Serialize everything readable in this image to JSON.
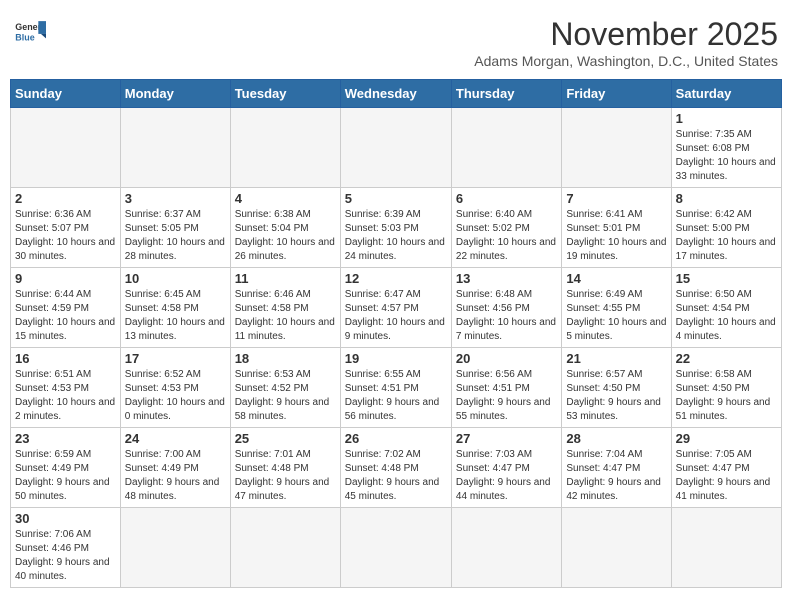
{
  "header": {
    "logo_general": "General",
    "logo_blue": "Blue",
    "month_title": "November 2025",
    "location": "Adams Morgan, Washington, D.C., United States"
  },
  "days_of_week": [
    "Sunday",
    "Monday",
    "Tuesday",
    "Wednesday",
    "Thursday",
    "Friday",
    "Saturday"
  ],
  "weeks": [
    [
      {
        "day": "",
        "info": ""
      },
      {
        "day": "",
        "info": ""
      },
      {
        "day": "",
        "info": ""
      },
      {
        "day": "",
        "info": ""
      },
      {
        "day": "",
        "info": ""
      },
      {
        "day": "",
        "info": ""
      },
      {
        "day": "1",
        "info": "Sunrise: 7:35 AM\nSunset: 6:08 PM\nDaylight: 10 hours\nand 33 minutes."
      }
    ],
    [
      {
        "day": "2",
        "info": "Sunrise: 6:36 AM\nSunset: 5:07 PM\nDaylight: 10 hours\nand 30 minutes."
      },
      {
        "day": "3",
        "info": "Sunrise: 6:37 AM\nSunset: 5:05 PM\nDaylight: 10 hours\nand 28 minutes."
      },
      {
        "day": "4",
        "info": "Sunrise: 6:38 AM\nSunset: 5:04 PM\nDaylight: 10 hours\nand 26 minutes."
      },
      {
        "day": "5",
        "info": "Sunrise: 6:39 AM\nSunset: 5:03 PM\nDaylight: 10 hours\nand 24 minutes."
      },
      {
        "day": "6",
        "info": "Sunrise: 6:40 AM\nSunset: 5:02 PM\nDaylight: 10 hours\nand 22 minutes."
      },
      {
        "day": "7",
        "info": "Sunrise: 6:41 AM\nSunset: 5:01 PM\nDaylight: 10 hours\nand 19 minutes."
      },
      {
        "day": "8",
        "info": "Sunrise: 6:42 AM\nSunset: 5:00 PM\nDaylight: 10 hours\nand 17 minutes."
      }
    ],
    [
      {
        "day": "9",
        "info": "Sunrise: 6:44 AM\nSunset: 4:59 PM\nDaylight: 10 hours\nand 15 minutes."
      },
      {
        "day": "10",
        "info": "Sunrise: 6:45 AM\nSunset: 4:58 PM\nDaylight: 10 hours\nand 13 minutes."
      },
      {
        "day": "11",
        "info": "Sunrise: 6:46 AM\nSunset: 4:58 PM\nDaylight: 10 hours\nand 11 minutes."
      },
      {
        "day": "12",
        "info": "Sunrise: 6:47 AM\nSunset: 4:57 PM\nDaylight: 10 hours\nand 9 minutes."
      },
      {
        "day": "13",
        "info": "Sunrise: 6:48 AM\nSunset: 4:56 PM\nDaylight: 10 hours\nand 7 minutes."
      },
      {
        "day": "14",
        "info": "Sunrise: 6:49 AM\nSunset: 4:55 PM\nDaylight: 10 hours\nand 5 minutes."
      },
      {
        "day": "15",
        "info": "Sunrise: 6:50 AM\nSunset: 4:54 PM\nDaylight: 10 hours\nand 4 minutes."
      }
    ],
    [
      {
        "day": "16",
        "info": "Sunrise: 6:51 AM\nSunset: 4:53 PM\nDaylight: 10 hours\nand 2 minutes."
      },
      {
        "day": "17",
        "info": "Sunrise: 6:52 AM\nSunset: 4:53 PM\nDaylight: 10 hours\nand 0 minutes."
      },
      {
        "day": "18",
        "info": "Sunrise: 6:53 AM\nSunset: 4:52 PM\nDaylight: 9 hours\nand 58 minutes."
      },
      {
        "day": "19",
        "info": "Sunrise: 6:55 AM\nSunset: 4:51 PM\nDaylight: 9 hours\nand 56 minutes."
      },
      {
        "day": "20",
        "info": "Sunrise: 6:56 AM\nSunset: 4:51 PM\nDaylight: 9 hours\nand 55 minutes."
      },
      {
        "day": "21",
        "info": "Sunrise: 6:57 AM\nSunset: 4:50 PM\nDaylight: 9 hours\nand 53 minutes."
      },
      {
        "day": "22",
        "info": "Sunrise: 6:58 AM\nSunset: 4:50 PM\nDaylight: 9 hours\nand 51 minutes."
      }
    ],
    [
      {
        "day": "23",
        "info": "Sunrise: 6:59 AM\nSunset: 4:49 PM\nDaylight: 9 hours\nand 50 minutes."
      },
      {
        "day": "24",
        "info": "Sunrise: 7:00 AM\nSunset: 4:49 PM\nDaylight: 9 hours\nand 48 minutes."
      },
      {
        "day": "25",
        "info": "Sunrise: 7:01 AM\nSunset: 4:48 PM\nDaylight: 9 hours\nand 47 minutes."
      },
      {
        "day": "26",
        "info": "Sunrise: 7:02 AM\nSunset: 4:48 PM\nDaylight: 9 hours\nand 45 minutes."
      },
      {
        "day": "27",
        "info": "Sunrise: 7:03 AM\nSunset: 4:47 PM\nDaylight: 9 hours\nand 44 minutes."
      },
      {
        "day": "28",
        "info": "Sunrise: 7:04 AM\nSunset: 4:47 PM\nDaylight: 9 hours\nand 42 minutes."
      },
      {
        "day": "29",
        "info": "Sunrise: 7:05 AM\nSunset: 4:47 PM\nDaylight: 9 hours\nand 41 minutes."
      }
    ],
    [
      {
        "day": "30",
        "info": "Sunrise: 7:06 AM\nSunset: 4:46 PM\nDaylight: 9 hours\nand 40 minutes."
      },
      {
        "day": "",
        "info": ""
      },
      {
        "day": "",
        "info": ""
      },
      {
        "day": "",
        "info": ""
      },
      {
        "day": "",
        "info": ""
      },
      {
        "day": "",
        "info": ""
      },
      {
        "day": "",
        "info": ""
      }
    ]
  ]
}
